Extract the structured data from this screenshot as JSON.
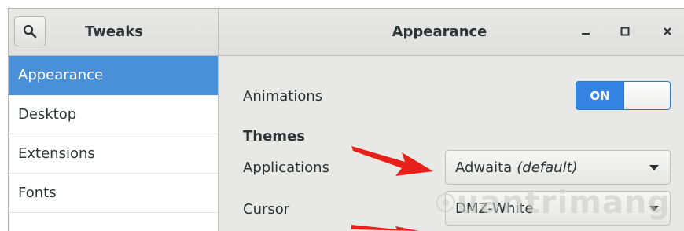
{
  "header": {
    "sidebar_title": "Tweaks",
    "main_title": "Appearance",
    "search_icon": "search-icon",
    "window_controls": [
      "minimize-icon",
      "maximize-icon",
      "close-icon"
    ]
  },
  "sidebar": {
    "items": [
      {
        "label": "Appearance",
        "active": true
      },
      {
        "label": "Desktop",
        "active": false
      },
      {
        "label": "Extensions",
        "active": false
      },
      {
        "label": "Fonts",
        "active": false
      }
    ]
  },
  "main": {
    "animations": {
      "label": "Animations",
      "toggle_label": "ON",
      "value": true
    },
    "themes": {
      "title": "Themes",
      "applications": {
        "label": "Applications",
        "value": "Adwaita",
        "suffix": "(default)"
      },
      "cursor": {
        "label": "Cursor",
        "value": "DMZ-White"
      }
    }
  },
  "annotations": {
    "arrow_color": "#e8201a"
  },
  "watermark": {
    "text": "uantrimang"
  },
  "colors": {
    "accent": "#4a90d9",
    "switch_on": "#3584e4"
  }
}
